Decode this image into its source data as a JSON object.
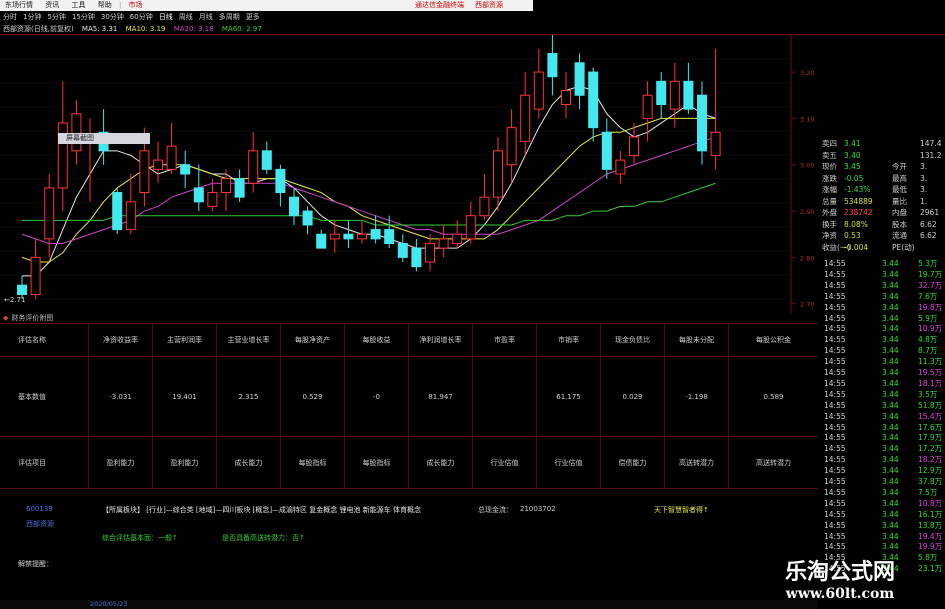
{
  "menubar": {
    "items": [
      "东场行情",
      "资讯",
      "工具",
      "帮助"
    ],
    "tab": "市场"
  },
  "banner": {
    "left": "通达信金融终端",
    "right": "西部资源"
  },
  "timeframes": [
    "分时",
    "1分钟",
    "5分钟",
    "15分钟",
    "30分钟",
    "60分钟",
    "日线",
    "周线",
    "月线",
    "多周期",
    "更多"
  ],
  "ma_bar": {
    "title": "西部资源(日线,前复权)",
    "ma5": "MA5: 3.31",
    "ma10": "MA10: 3.19",
    "ma20": "MA20: 3.18",
    "ma60": "MA60: 2.97"
  },
  "chart": {
    "tooltip": "屏幕截图",
    "low_label": "←2.71",
    "y_ticks": [
      "3.20",
      "3.10",
      "3.00",
      "2.90",
      "2.80",
      "2.70"
    ]
  },
  "quote": [
    {
      "label": "卖四",
      "value": "3.41",
      "extra": "147.4",
      "vc": "#33dd33"
    },
    {
      "label": "卖五",
      "value": "3.40",
      "extra": "131.2",
      "vc": "#33dd33"
    },
    {
      "label": "现价",
      "value": "3.45",
      "label2": "今开",
      "extra": "3.",
      "vc": "#33dd33"
    },
    {
      "label": "涨跌",
      "value": "-0.05",
      "label2": "最高",
      "extra": "3.",
      "vc": "#33dd33"
    },
    {
      "label": "涨幅",
      "value": "-1.43%",
      "label2": "最低",
      "extra": "3.",
      "vc": "#33dd33"
    },
    {
      "label": "总量",
      "value": "534889",
      "label2": "量比",
      "extra": "1.",
      "vc": "#dddd33"
    },
    {
      "label": "外盘",
      "value": "238742",
      "label2": "内盘",
      "extra": "2961",
      "vc": "#ff4444"
    },
    {
      "label": "换手",
      "value": "8.08%",
      "label2": "股本",
      "extra": "6.62",
      "vc": "#dddd33"
    },
    {
      "label": "净资",
      "value": "0.53",
      "label2": "流通",
      "extra": "6.62",
      "vc": "#dddd33"
    },
    {
      "label": "收益(一)",
      "value": "-0.004",
      "label2": "PE(动)",
      "extra": "",
      "vc": "#dddd33"
    }
  ],
  "ticks": [
    {
      "t": "14:55",
      "p": "3.44",
      "v": "5.3万"
    },
    {
      "t": "14:55",
      "p": "3.44",
      "v": "19.7万"
    },
    {
      "t": "14:55",
      "p": "3.44",
      "v": "32.7万"
    },
    {
      "t": "14:55",
      "p": "3.44",
      "v": "7.6万"
    },
    {
      "t": "14:55",
      "p": "3.44",
      "v": "19.8万"
    },
    {
      "t": "14:55",
      "p": "3.44",
      "v": "5.9万"
    },
    {
      "t": "14:55",
      "p": "3.44",
      "v": "10.9万"
    },
    {
      "t": "14:55",
      "p": "3.44",
      "v": "4.8万"
    },
    {
      "t": "14:55",
      "p": "3.44",
      "v": "8.7万"
    },
    {
      "t": "14:55",
      "p": "3.44",
      "v": "11.3万"
    },
    {
      "t": "14:55",
      "p": "3.44",
      "v": "19.5万"
    },
    {
      "t": "14:55",
      "p": "3.44",
      "v": "18.1万"
    },
    {
      "t": "14:55",
      "p": "3.44",
      "v": "3.5万"
    },
    {
      "t": "14:55",
      "p": "3.44",
      "v": "51.8万"
    },
    {
      "t": "14:55",
      "p": "3.44",
      "v": "15.4万"
    },
    {
      "t": "14:55",
      "p": "3.44",
      "v": "17.6万"
    },
    {
      "t": "14:55",
      "p": "3.44",
      "v": "17.9万"
    },
    {
      "t": "14:55",
      "p": "3.44",
      "v": "17.2万"
    },
    {
      "t": "14:55",
      "p": "3.44",
      "v": "18.2万"
    },
    {
      "t": "14:55",
      "p": "3.44",
      "v": "12.9万"
    },
    {
      "t": "14:55",
      "p": "3.44",
      "v": "37.8万"
    },
    {
      "t": "14:55",
      "p": "3.44",
      "v": "7.5万"
    },
    {
      "t": "14:55",
      "p": "3.44",
      "v": "10.8万"
    },
    {
      "t": "14:55",
      "p": "3.44",
      "v": "16.1万"
    },
    {
      "t": "14:55",
      "p": "3.44",
      "v": "13.8万"
    },
    {
      "t": "14:55",
      "p": "3.44",
      "v": "19.4万"
    },
    {
      "t": "14:55",
      "p": "3.44",
      "v": "19.9万"
    },
    {
      "t": "14:55",
      "p": "3.44",
      "v": "5.8万"
    },
    {
      "t": "14:55",
      "p": "3.44",
      "v": "23.1万"
    }
  ],
  "fin_title": "财务评价附图",
  "fin_table": {
    "headers": [
      "评估名称",
      "净资收益率",
      "主营利润率",
      "主营业增长率",
      "每股净资产",
      "每股收益",
      "净利润增长率",
      "市盈率",
      "市销率",
      "现金负债比",
      "每股未分配",
      "每股公积金"
    ],
    "row1": [
      "基本数值",
      "-3.031",
      "19.401",
      "2.315",
      "0.529",
      "-0",
      "81.947",
      "",
      "61.175",
      "0.029",
      "-1.198",
      "0.589"
    ],
    "row2": [
      "评估项目",
      "盈利能力",
      "盈利能力",
      "成长能力",
      "每股指标",
      "每股指标",
      "成长能力",
      "行业估值",
      "行业估值",
      "偿债能力",
      "高送转潜力",
      "高送转潜力"
    ]
  },
  "info": {
    "code": "600139",
    "name": "西部资源",
    "sector": "【所属板块】 [行业]—综合类 [地域]—四川板块 [概念]—成渝特区 复金概念 锂电池 新能源车 体育概念",
    "capital_label": "总现金流：",
    "capital_value": "21003702",
    "tag": "天下智慧智者得↑",
    "eval_label": "综合评估基本面：一般↑",
    "transfer_label": "是否具备高送转潜力：否↑",
    "note_label": "解禁提醒："
  },
  "footer": {
    "left": "",
    "date": "2020/05/23"
  },
  "watermark": {
    "cn": "乐淘公式网",
    "url": "www.60lt.com"
  },
  "colors": {
    "up": "#ff3333",
    "down": "#44e8f0",
    "ma5": "#e8e8e8",
    "ma10": "#e8e840",
    "ma20": "#cc44cc",
    "ma60": "#33cc33"
  },
  "candles": [
    {
      "o": 2.74,
      "c": 2.72,
      "h": 2.76,
      "l": 2.71
    },
    {
      "o": 2.72,
      "c": 2.8,
      "h": 2.84,
      "l": 2.71
    },
    {
      "o": 2.84,
      "c": 2.95,
      "h": 2.98,
      "l": 2.8
    },
    {
      "o": 2.95,
      "c": 3.09,
      "h": 3.18,
      "l": 2.9
    },
    {
      "o": 3.03,
      "c": 3.11,
      "h": 3.14,
      "l": 3.0
    },
    {
      "o": 3.05,
      "c": 3.06,
      "h": 3.1,
      "l": 2.92
    },
    {
      "o": 3.07,
      "c": 3.03,
      "h": 3.12,
      "l": 3.0
    },
    {
      "o": 2.94,
      "c": 2.86,
      "h": 2.95,
      "l": 2.85
    },
    {
      "o": 2.86,
      "c": 2.92,
      "h": 2.98,
      "l": 2.85
    },
    {
      "o": 2.94,
      "c": 3.03,
      "h": 3.08,
      "l": 2.91
    },
    {
      "o": 2.99,
      "c": 3.01,
      "h": 3.05,
      "l": 2.96
    },
    {
      "o": 2.99,
      "c": 3.04,
      "h": 3.09,
      "l": 2.98
    },
    {
      "o": 3.0,
      "c": 2.98,
      "h": 3.03,
      "l": 2.95
    },
    {
      "o": 2.95,
      "c": 2.92,
      "h": 3.0,
      "l": 2.9
    },
    {
      "o": 2.91,
      "c": 2.94,
      "h": 2.97,
      "l": 2.9
    },
    {
      "o": 2.94,
      "c": 2.97,
      "h": 2.99,
      "l": 2.9
    },
    {
      "o": 2.97,
      "c": 2.93,
      "h": 2.99,
      "l": 2.92
    },
    {
      "o": 2.96,
      "c": 3.03,
      "h": 3.07,
      "l": 2.94
    },
    {
      "o": 3.03,
      "c": 2.99,
      "h": 3.05,
      "l": 2.98
    },
    {
      "o": 2.99,
      "c": 2.94,
      "h": 3.0,
      "l": 2.91
    },
    {
      "o": 2.93,
      "c": 2.89,
      "h": 2.95,
      "l": 2.87
    },
    {
      "o": 2.9,
      "c": 2.87,
      "h": 2.91,
      "l": 2.85
    },
    {
      "o": 2.85,
      "c": 2.82,
      "h": 2.86,
      "l": 2.82
    },
    {
      "o": 2.84,
      "c": 2.85,
      "h": 2.88,
      "l": 2.81
    },
    {
      "o": 2.85,
      "c": 2.84,
      "h": 2.88,
      "l": 2.82
    },
    {
      "o": 2.84,
      "c": 2.85,
      "h": 2.88,
      "l": 2.83
    },
    {
      "o": 2.86,
      "c": 2.84,
      "h": 2.89,
      "l": 2.83
    },
    {
      "o": 2.86,
      "c": 2.83,
      "h": 2.89,
      "l": 2.82
    },
    {
      "o": 2.83,
      "c": 2.8,
      "h": 2.85,
      "l": 2.79
    },
    {
      "o": 2.82,
      "c": 2.78,
      "h": 2.84,
      "l": 2.77
    },
    {
      "o": 2.79,
      "c": 2.83,
      "h": 2.85,
      "l": 2.77
    },
    {
      "o": 2.82,
      "c": 2.84,
      "h": 2.87,
      "l": 2.8
    },
    {
      "o": 2.83,
      "c": 2.85,
      "h": 2.88,
      "l": 2.82
    },
    {
      "o": 2.84,
      "c": 2.89,
      "h": 2.92,
      "l": 2.83
    },
    {
      "o": 2.89,
      "c": 2.93,
      "h": 2.98,
      "l": 2.88
    },
    {
      "o": 2.93,
      "c": 3.03,
      "h": 3.06,
      "l": 2.9
    },
    {
      "o": 3.0,
      "c": 3.08,
      "h": 3.12,
      "l": 2.96
    },
    {
      "o": 3.05,
      "c": 3.15,
      "h": 3.2,
      "l": 3.02
    },
    {
      "o": 3.12,
      "c": 3.2,
      "h": 3.25,
      "l": 3.1
    },
    {
      "o": 3.24,
      "c": 3.19,
      "h": 3.28,
      "l": 3.15
    },
    {
      "o": 3.13,
      "c": 3.16,
      "h": 3.2,
      "l": 3.1
    },
    {
      "o": 3.22,
      "c": 3.15,
      "h": 3.24,
      "l": 3.12
    },
    {
      "o": 3.2,
      "c": 3.08,
      "h": 3.21,
      "l": 3.05
    },
    {
      "o": 3.07,
      "c": 2.99,
      "h": 3.1,
      "l": 2.97
    },
    {
      "o": 2.98,
      "c": 3.01,
      "h": 3.03,
      "l": 2.96
    },
    {
      "o": 3.02,
      "c": 3.06,
      "h": 3.09,
      "l": 3.0
    },
    {
      "o": 3.1,
      "c": 3.15,
      "h": 3.18,
      "l": 3.05
    },
    {
      "o": 3.18,
      "c": 3.13,
      "h": 3.2,
      "l": 3.1
    },
    {
      "o": 3.12,
      "c": 3.18,
      "h": 3.22,
      "l": 3.08
    },
    {
      "o": 3.18,
      "c": 3.12,
      "h": 3.22,
      "l": 3.11
    },
    {
      "o": 3.15,
      "c": 3.03,
      "h": 3.18,
      "l": 3.0
    },
    {
      "o": 3.02,
      "c": 3.07,
      "h": 3.25,
      "l": 2.99
    }
  ],
  "ma_lines": {
    "ma5": [
      2.76,
      2.76,
      2.79,
      2.86,
      2.93,
      2.98,
      3.03,
      3.03,
      3.02,
      3.0,
      2.98,
      2.99,
      3.0,
      2.99,
      2.98,
      2.98,
      2.96,
      2.96,
      2.97,
      2.97,
      2.95,
      2.92,
      2.89,
      2.87,
      2.86,
      2.85,
      2.85,
      2.84,
      2.83,
      2.82,
      2.82,
      2.82,
      2.82,
      2.84,
      2.87,
      2.91,
      2.96,
      3.02,
      3.08,
      3.13,
      3.16,
      3.17,
      3.16,
      3.11,
      3.08,
      3.06,
      3.07,
      3.09,
      3.11,
      3.13,
      3.11,
      3.1
    ],
    "ma10": [
      2.8,
      2.79,
      2.79,
      2.81,
      2.85,
      2.88,
      2.92,
      2.95,
      2.97,
      2.99,
      3.0,
      3.0,
      3.0,
      2.99,
      2.98,
      2.97,
      2.97,
      2.97,
      2.97,
      2.97,
      2.96,
      2.95,
      2.94,
      2.92,
      2.91,
      2.89,
      2.88,
      2.87,
      2.86,
      2.85,
      2.84,
      2.84,
      2.84,
      2.84,
      2.84,
      2.86,
      2.89,
      2.92,
      2.95,
      2.98,
      3.01,
      3.04,
      3.06,
      3.07,
      3.07,
      3.08,
      3.09,
      3.1,
      3.1,
      3.1,
      3.1,
      3.1
    ],
    "ma20": [
      2.85,
      2.84,
      2.83,
      2.83,
      2.84,
      2.85,
      2.86,
      2.87,
      2.88,
      2.9,
      2.91,
      2.93,
      2.94,
      2.95,
      2.96,
      2.96,
      2.96,
      2.96,
      2.96,
      2.96,
      2.95,
      2.94,
      2.93,
      2.92,
      2.91,
      2.9,
      2.89,
      2.88,
      2.87,
      2.86,
      2.86,
      2.85,
      2.85,
      2.85,
      2.85,
      2.85,
      2.86,
      2.87,
      2.88,
      2.9,
      2.92,
      2.94,
      2.96,
      2.98,
      2.99,
      3.0,
      3.01,
      3.02,
      3.03,
      3.04,
      3.05,
      3.06
    ],
    "ma60": [
      2.88,
      2.88,
      2.88,
      2.88,
      2.88,
      2.88,
      2.88,
      2.89,
      2.89,
      2.89,
      2.89,
      2.89,
      2.89,
      2.89,
      2.89,
      2.89,
      2.89,
      2.89,
      2.89,
      2.89,
      2.89,
      2.89,
      2.88,
      2.88,
      2.88,
      2.88,
      2.87,
      2.87,
      2.87,
      2.87,
      2.87,
      2.87,
      2.87,
      2.87,
      2.87,
      2.87,
      2.87,
      2.88,
      2.88,
      2.88,
      2.89,
      2.89,
      2.9,
      2.9,
      2.91,
      2.91,
      2.92,
      2.92,
      2.93,
      2.94,
      2.95,
      2.96
    ]
  }
}
